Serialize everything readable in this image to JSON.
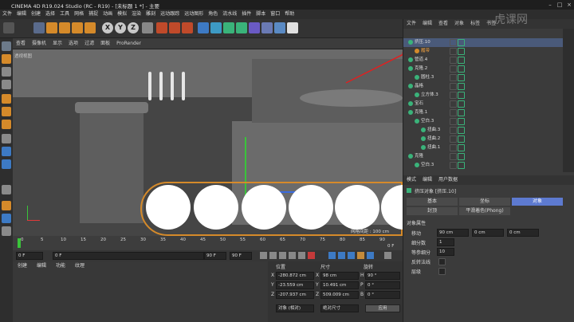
{
  "app": {
    "title": "CINEMA 4D R19.024 Studio (RC - R19) - [未标题 1 *] - 主要"
  },
  "menu": [
    "文件",
    "编辑",
    "创建",
    "选择",
    "工具",
    "网格",
    "捕捉",
    "动画",
    "模拟",
    "渲染",
    "雕刻",
    "运动跟踪",
    "运动图形",
    "角色",
    "流水线",
    "插件",
    "脚本",
    "窗口",
    "帮助"
  ],
  "toolbar": {
    "xyz": [
      "X",
      "Y",
      "Z"
    ]
  },
  "viewport_menu": [
    "查看",
    "摄像机",
    "显示",
    "选项",
    "过滤",
    "面板",
    "ProRender"
  ],
  "viewport": {
    "label": "透视视图",
    "grid_text": "网格间距 : 100 cm"
  },
  "timeline": {
    "ticks": [
      "0",
      "5",
      "10",
      "15",
      "20",
      "25",
      "30",
      "35",
      "40",
      "45",
      "50",
      "55",
      "60",
      "65",
      "70",
      "75",
      "80",
      "85",
      "90"
    ],
    "unit": "0 F"
  },
  "playbar": {
    "start": "0 F",
    "current": "0 F",
    "end": "90 F",
    "end2": "90 F"
  },
  "materials": {
    "tabs": [
      "创建",
      "编辑",
      "功能",
      "纹理"
    ]
  },
  "coords": {
    "headers": [
      "位置",
      "尺寸",
      "旋转"
    ],
    "rows": [
      {
        "axis": "X",
        "pos": "-280.872 cm",
        "size_axis": "X",
        "size": "98 cm",
        "rot_axis": "H",
        "rot": "90 °"
      },
      {
        "axis": "Y",
        "pos": "-23.559 cm",
        "size_axis": "Y",
        "size": "10.491 cm",
        "rot_axis": "P",
        "rot": "0 °"
      },
      {
        "axis": "Z",
        "pos": "-207.937 cm",
        "size_axis": "Z",
        "size": "509.009 cm",
        "rot_axis": "B",
        "rot": "0 °"
      }
    ],
    "mode_object": "对象 (相对)",
    "mode_size": "绝对尺寸",
    "apply": "应用"
  },
  "object_panel": {
    "tabs": [
      "文件",
      "编辑",
      "查看",
      "对象",
      "标签",
      "书签"
    ],
    "objects": [
      {
        "name": "挤压.10",
        "indent": 0,
        "selected": true
      },
      {
        "name": "履带",
        "indent": 1,
        "selected": false,
        "orange": true
      },
      {
        "name": "管道.4",
        "indent": 0,
        "selected": false
      },
      {
        "name": "克隆.2",
        "indent": 0,
        "selected": false
      },
      {
        "name": "圆柱.3",
        "indent": 1,
        "selected": false
      },
      {
        "name": "晶格",
        "indent": 0,
        "selected": false
      },
      {
        "name": "立方体.3",
        "indent": 1,
        "selected": false
      },
      {
        "name": "宝石",
        "indent": 0,
        "selected": false
      },
      {
        "name": "克隆.1",
        "indent": 0,
        "selected": false
      },
      {
        "name": "空白.3",
        "indent": 1,
        "selected": false
      },
      {
        "name": "扭曲.3",
        "indent": 2,
        "selected": false
      },
      {
        "name": "扭曲.2",
        "indent": 2,
        "selected": false
      },
      {
        "name": "扭曲.1",
        "indent": 2,
        "selected": false
      },
      {
        "name": "克隆",
        "indent": 0,
        "selected": false
      },
      {
        "name": "空白.3",
        "indent": 1,
        "selected": false
      }
    ]
  },
  "attr": {
    "tabs": [
      "模式",
      "编辑",
      "用户数据"
    ],
    "title": "挤压对象 [挤压.10]",
    "subtabs": [
      "基本",
      "坐标",
      "对象"
    ],
    "subtabs2": [
      "封顶",
      "平滑着色(Phong)"
    ],
    "section": "对象属性",
    "fields": [
      {
        "label": "移动",
        "v1": "90 cm",
        "v2": "0 cm",
        "v3": "0 cm"
      },
      {
        "label": "细分数",
        "v1": "1"
      },
      {
        "label": "等参细分",
        "v1": "10"
      },
      {
        "label": "反转法线",
        "v1": ""
      },
      {
        "label": "层级",
        "v1": ""
      }
    ]
  },
  "watermark": "虎课网"
}
